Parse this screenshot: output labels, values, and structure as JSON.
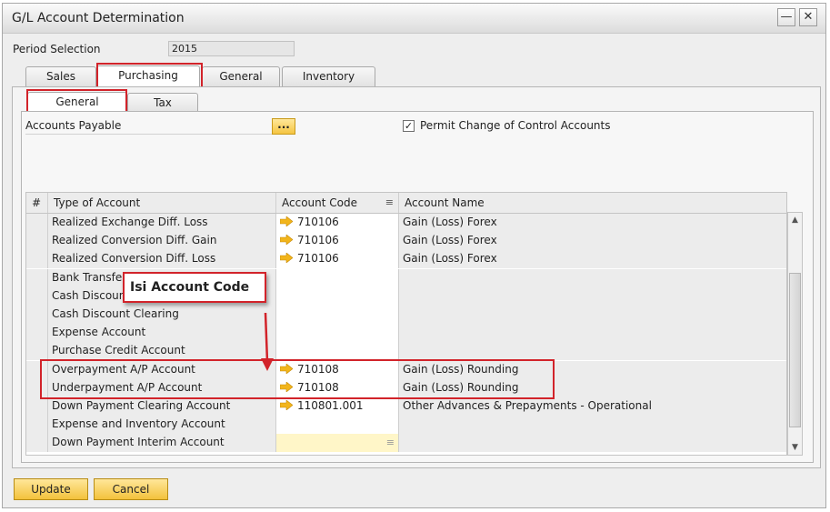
{
  "window": {
    "title": "G/L Account Determination"
  },
  "period": {
    "label": "Period Selection",
    "value": "2015"
  },
  "tabs": [
    {
      "label": "Sales"
    },
    {
      "label": "Purchasing"
    },
    {
      "label": "General"
    },
    {
      "label": "Inventory"
    }
  ],
  "subtabs": [
    {
      "label": "General"
    },
    {
      "label": "Tax"
    }
  ],
  "accounts_payable": {
    "label": "Accounts Payable",
    "button_label": "..."
  },
  "permit_change": {
    "label": "Permit Change of Control Accounts",
    "checked": "✓"
  },
  "grid": {
    "columns": {
      "num": "#",
      "type": "Type of Account",
      "code": "Account Code",
      "name": "Account Name"
    },
    "rows": [
      {
        "type": "Realized Exchange Diff. Loss",
        "code": "710106",
        "name": "Gain (Loss) Forex"
      },
      {
        "type": "Realized Conversion Diff. Gain",
        "code": "710106",
        "name": "Gain (Loss) Forex"
      },
      {
        "type": "Realized Conversion Diff. Loss",
        "code": "710106",
        "name": "Gain (Loss) Forex"
      },
      {
        "type": "Bank Transfer",
        "code": "",
        "name": ""
      },
      {
        "type": "Cash Discount",
        "code": "",
        "name": ""
      },
      {
        "type": "Cash Discount Clearing",
        "code": "",
        "name": ""
      },
      {
        "type": "Expense Account",
        "code": "",
        "name": ""
      },
      {
        "type": "Purchase Credit Account",
        "code": "",
        "name": ""
      },
      {
        "type": "Overpayment A/P Account",
        "code": "710108",
        "name": "Gain (Loss) Rounding"
      },
      {
        "type": "Underpayment A/P Account",
        "code": "710108",
        "name": "Gain (Loss) Rounding"
      },
      {
        "type": "Down Payment Clearing Account",
        "code": "110801.001",
        "name": "Other Advances & Prepayments - Operational"
      },
      {
        "type": "Expense and Inventory Account",
        "code": "",
        "name": ""
      },
      {
        "type": "Down Payment Interim Account",
        "code": "",
        "name": ""
      }
    ]
  },
  "callout": {
    "text": "Isi Account Code"
  },
  "buttons": {
    "update": "Update",
    "cancel": "Cancel"
  },
  "colors": {
    "highlight": "#d2232a",
    "button_yellow": "#f3c23c",
    "link_arrow": "#f2b51b"
  }
}
